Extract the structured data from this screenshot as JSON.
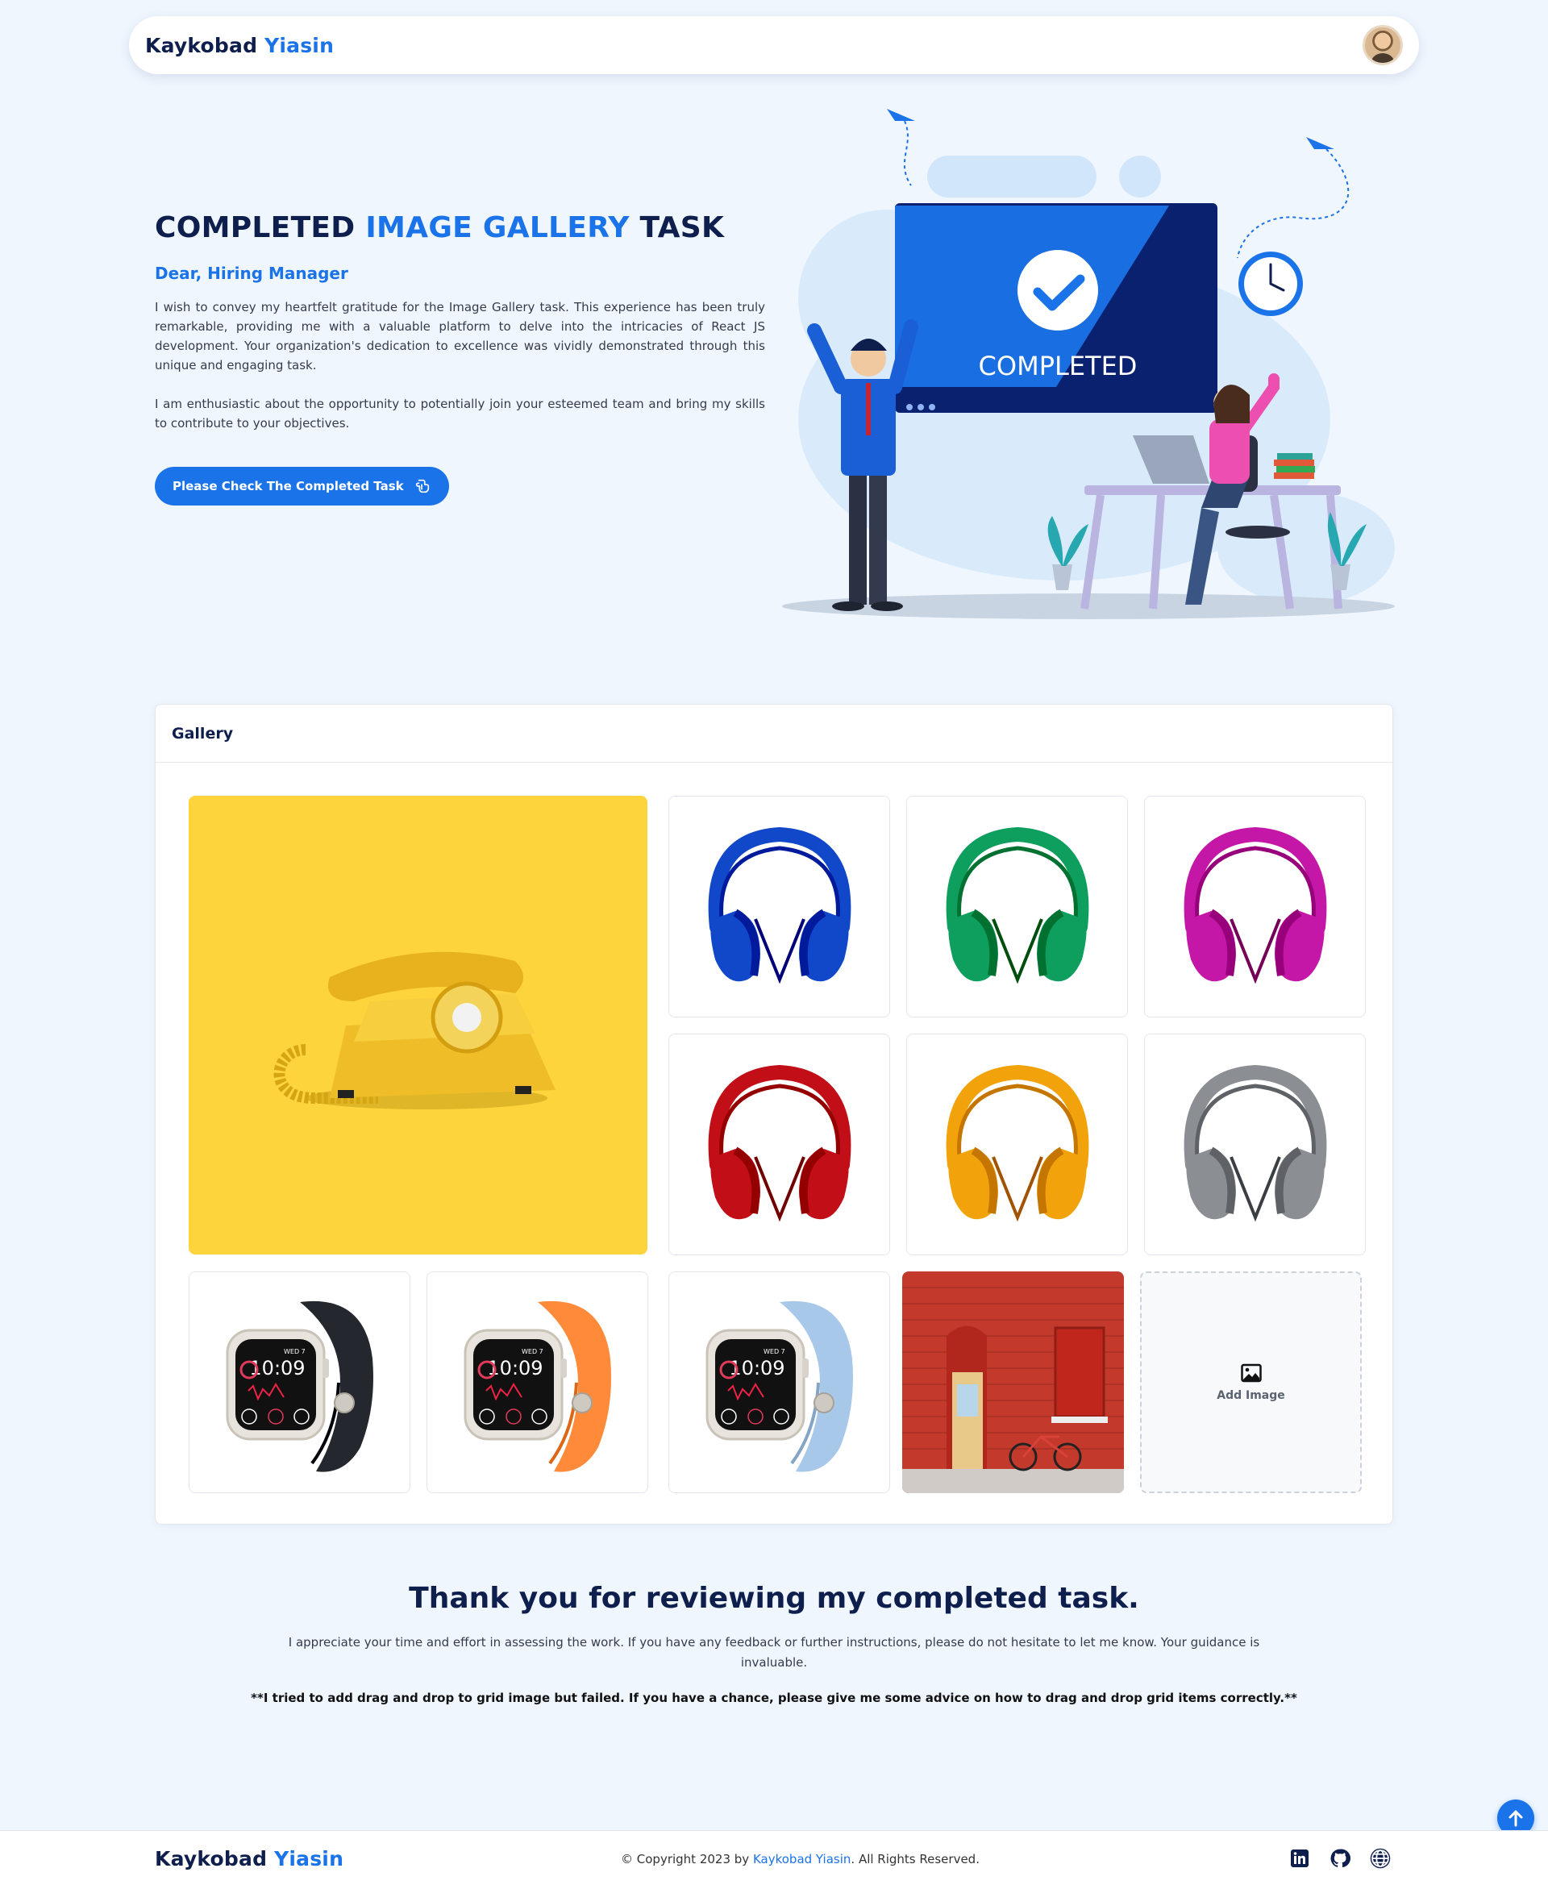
{
  "navbar": {
    "brand_first": "Kaykobad",
    "brand_second": "Yiasin"
  },
  "hero": {
    "title_part1": "COMPLETED",
    "title_part2": "IMAGE GALLERY",
    "title_part3": "TASK",
    "greeting": "Dear, Hiring Manager",
    "paragraph1": "I wish to convey my heartfelt gratitude for the Image Gallery task. This experience has been truly remarkable, providing me with a valuable platform to delve into the intricacies of React JS development. Your organization's dedication to excellence was vividly demonstrated through this unique and engaging task.",
    "paragraph2": "I am enthusiastic about the opportunity to potentially join your esteemed team and bring my skills to contribute to your objectives.",
    "cta_label": "Please Check The Completed Task",
    "illustration_label": "COMPLETED"
  },
  "gallery": {
    "title": "Gallery",
    "add_image_label": "Add Image",
    "watch_time": "10:09",
    "watch_date": "WED 7",
    "items": [
      {
        "kind": "telephone",
        "color": "#f2c230"
      },
      {
        "kind": "headphones",
        "color": "#1147c9"
      },
      {
        "kind": "headphones",
        "color": "#0e9e5d"
      },
      {
        "kind": "headphones",
        "color": "#c417a7"
      },
      {
        "kind": "headphones",
        "color": "#c10e17"
      },
      {
        "kind": "headphones",
        "color": "#f2a30c"
      },
      {
        "kind": "headphones",
        "color": "#8b8f93"
      },
      {
        "kind": "watch",
        "color": "#24272d"
      },
      {
        "kind": "watch",
        "color": "#ff8a3a"
      },
      {
        "kind": "watch",
        "color": "#a8c8ea"
      },
      {
        "kind": "photo-brick-wall",
        "color": "#c3392b"
      }
    ]
  },
  "thanks": {
    "heading": "Thank you for reviewing my completed task.",
    "paragraph": "I appreciate your time and effort in assessing the work. If you have any feedback or further instructions, please do not hesitate to let me know. Your guidance is invaluable.",
    "note": "**I tried to add drag and drop to grid image but failed. If you have a chance, please give me some advice on how to drag and drop grid items correctly.**"
  },
  "footer": {
    "brand_first": "Kaykobad",
    "brand_second": "Yiasin",
    "copyright_prefix": "© Copyright 2023 by",
    "copyright_name": "Kaykobad Yiasin",
    "copyright_suffix": ". All Rights Reserved.",
    "socials": [
      "linkedin-icon",
      "github-icon",
      "globe-icon"
    ]
  },
  "colors": {
    "accent": "#1a73e8",
    "navy": "#0f1f4d",
    "background": "#eff6fe"
  }
}
